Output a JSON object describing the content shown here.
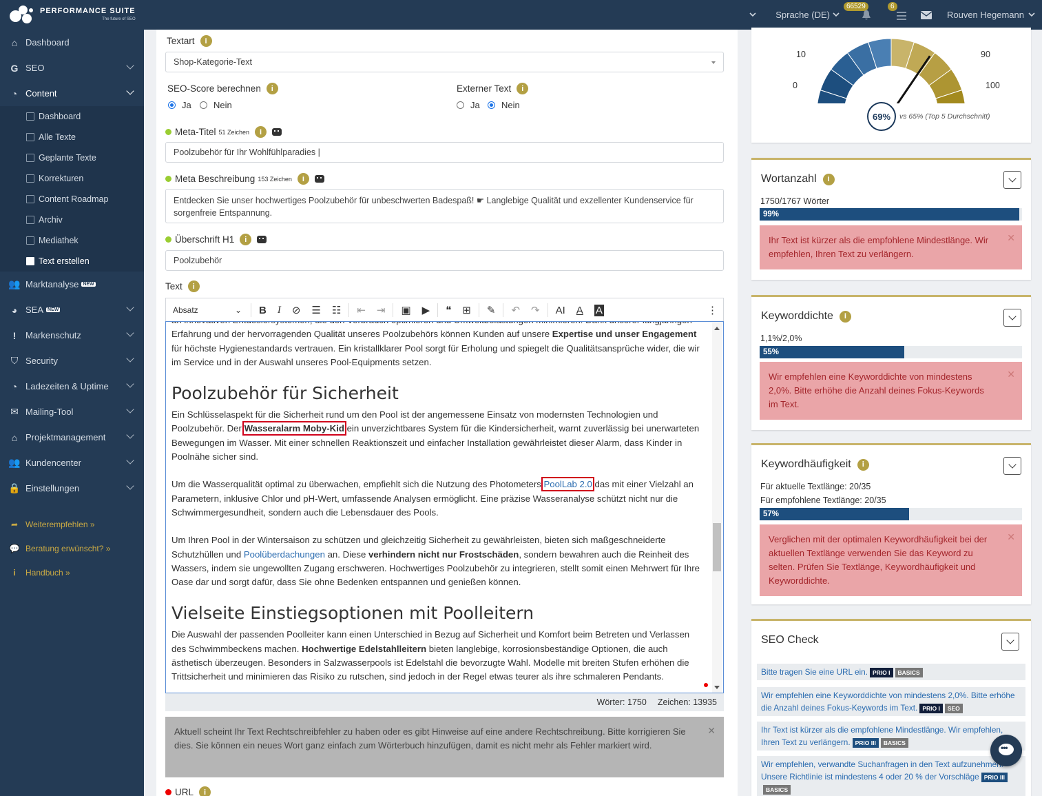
{
  "topbar": {
    "brand": "Performance Suite",
    "brand_sub": "The future of SEO",
    "language": "Sprache (DE)",
    "notif_count": "66529",
    "task_count": "6",
    "user": "Rouven Hegemann"
  },
  "sidebar": {
    "items": [
      {
        "label": "Dashboard"
      },
      {
        "label": "SEO"
      },
      {
        "label": "Content"
      },
      {
        "label": "Marktanalyse",
        "tag": "NEW"
      },
      {
        "label": "SEA",
        "tag": "NEW"
      },
      {
        "label": "Markenschutz"
      },
      {
        "label": "Security"
      },
      {
        "label": "Ladezeiten & Uptime"
      },
      {
        "label": "Mailing-Tool"
      },
      {
        "label": "Projektmanagement"
      },
      {
        "label": "Kundencenter"
      },
      {
        "label": "Einstellungen"
      }
    ],
    "content_sub": [
      "Dashboard",
      "Alle Texte",
      "Geplante Texte",
      "Korrekturen",
      "Content Roadmap",
      "Archiv",
      "Mediathek",
      "Text erstellen"
    ],
    "extras": [
      "Weiterempfehlen »",
      "Beratung erwünscht? »",
      "Handbuch »"
    ]
  },
  "form": {
    "textart_label": "Textart",
    "textart_value": "Shop-Kategorie-Text",
    "seo_score_label": "SEO-Score berechnen",
    "extern_label": "Externer Text",
    "ja": "Ja",
    "nein": "Nein",
    "meta_title_label": "Meta-Titel",
    "meta_title_count": "51 Zeichen",
    "meta_title_value": "Poolzubehör für Ihr Wohlfühlparadies |",
    "meta_desc_label": "Meta Beschreibung",
    "meta_desc_count": "153 Zeichen",
    "meta_desc_value": "Entdecken Sie unser hochwertiges Poolzubehör für unbeschwerten Badespaß! ☛ Langlebige Qualität und exzellenter Kundenservice für sorgenfreie Entspannung.",
    "h1_label": "Überschrift H1",
    "h1_value": "Poolzubehör",
    "text_label": "Text",
    "toolbar_format": "Absatz",
    "url_label": "URL"
  },
  "editor": {
    "p0a": "an innovativen Entdosiersystemen, die den Verbrauch optimieren und Umweltbelastungen minimieren. Dank unserer langjährigen Erfahrung und der hervorragenden Qualität unseres Poolzubehörs können Kunden auf unsere ",
    "p0b": "Expertise und unser Engagement",
    "p0c": " für höchste Hygienestandards vertrauen. Ein kristallklarer Pool sorgt für Erholung und spiegelt die Qualitätsansprüche wider, die wir im Service und in der Auswahl unseres Pool-Equipments setzen.",
    "h2a": "Poolzubehör für Sicherheit",
    "p1a": "Ein Schlüsselaspekt für die Sicherheit rund um den Pool ist der angemessene Einsatz von modernsten Technologien und Poolzubehör. Der ",
    "p1b": "Wasseralarm Moby-Kid",
    "p1c": " ein unverzichtbares System für die Kindersicherheit, warnt zuverlässig bei unerwarteten Bewegungen im Wasser. Mit einer schnellen Reaktionszeit und einfacher Installation gewährleistet dieser Alarm, dass Kinder in Poolnähe sicher sind.",
    "p2a": "Um die Wasserqualität optimal zu überwachen, empfiehlt sich die Nutzung des Photometers ",
    "p2b": "PoolLab 2.0",
    "p2c": " das mit einer Vielzahl an Parametern, inklusive Chlor und pH-Wert, umfassende Analysen ermöglicht. Eine präzise Wasseranalyse schützt nicht nur die Schwimmergesundheit, sondern auch die Lebensdauer des Pools.",
    "p3a": "Um Ihren Pool in der Wintersaison zu schützen und gleichzeitig Sicherheit zu gewährleisten, bieten sich maßgeschneiderte Schutzhüllen und ",
    "p3b": "Poolüberdachungen",
    "p3c": " an. Diese ",
    "p3d": "verhindern nicht nur Frostschäden",
    "p3e": ", sondern bewahren auch die Reinheit des Wassers, indem sie ungewollten Zugang erschweren. Hochwertiges Poolzubehör zu integrieren, stellt somit einen Mehrwert für Ihre Oase dar und sorgt dafür, dass Sie ohne Bedenken entspannen und genießen können.",
    "h2b": "Vielseite Einstiegsoptionen mit Poolleitern",
    "p4a": "Die Auswahl der passenden Poolleiter kann einen Unterschied in Bezug auf Sicherheit und Komfort beim Betreten und Verlassen des Schwimmbeckens machen. ",
    "p4b": "Hochwertige Edelstahlleitern",
    "p4c": " bieten langlebige, korrosionsbeständige Optionen, die auch ästhetisch überzeugen. Besonders in Salzwasserpools ist Edelstahl die bevorzugte Wahl. Modelle mit breiten Stufen erhöhen die Trittsicherheit und minimieren das Risiko zu rutschen, sind jedoch in der Regel etwas teurer als ihre schmaleren Pendants.",
    "words": "Wörter: 1750",
    "chars": "Zeichen: 13935"
  },
  "spellcheck": "Aktuell scheint Ihr Text Rechtschreibfehler zu haben oder es gibt Hinweise auf eine andere Rechtschreibung. Bitte korrigieren Sie dies. Sie können ein neues Wort ganz einfach zum Wörterbuch hinzufügen, damit es nicht mehr als Fehler markiert wird.",
  "gauge": {
    "labels": [
      "10",
      "0",
      "90",
      "100"
    ],
    "score": "69%",
    "compare": "vs 65% (Top 5 Durchschnitt)",
    "value": 69
  },
  "wortanzahl": {
    "title": "Wortanzahl",
    "text": "1750/1767 Wörter",
    "percent": 99,
    "percent_label": "99%",
    "alert": "Ihr Text ist kürzer als die empfohlene Mindestlänge. Wir empfehlen, Ihren Text zu verlängern."
  },
  "keyworddichte": {
    "title": "Keyworddichte",
    "text": "1,1%/2,0%",
    "percent": 55,
    "percent_label": "55%",
    "alert": "Wir empfehlen eine Keyworddichte von mindestens 2,0%. Bitte erhöhe die Anzahl deines Fokus-Keywords im Text."
  },
  "keywordhaeufigkeit": {
    "title": "Keywordhäufigkeit",
    "text1": "Für aktuelle Textlänge: 20/35",
    "text2": "Für empfohlene Textlänge: 20/35",
    "percent": 57,
    "percent_label": "57%",
    "alert": "Verglichen mit der optimalen Keywordhäufigkeit bei der aktuellen Textlänge verwenden Sie das Keyword zu selten. Prüfen Sie Textlänge, Keywordhäufigkeit und Keyworddichte."
  },
  "seocheck": {
    "title": "SEO Check",
    "items": [
      {
        "text": "Bitte tragen Sie eine URL ein.",
        "prio": "PRIO I",
        "cat": "BASICS"
      },
      {
        "text": "Wir empfehlen eine Keyworddichte von mindestens 2,0%. Bitte erhöhe die Anzahl deines Fokus-Keywords im Text.",
        "prio": "PRIO I",
        "cat": "SEO"
      },
      {
        "text": "Ihr Text ist kürzer als die empfohlene Mindestlänge. Wir empfehlen, Ihren Text zu verlängern.",
        "prio": "PRIO III",
        "cat": "BASICS"
      },
      {
        "text": "Wir empfehlen, verwandte Suchanfragen in den Text aufzunehmen. Unsere Richtlinie ist mindestens 4 oder 20 % der Vorschläge",
        "prio": "PRIO III",
        "cat": "BASICS"
      }
    ]
  }
}
